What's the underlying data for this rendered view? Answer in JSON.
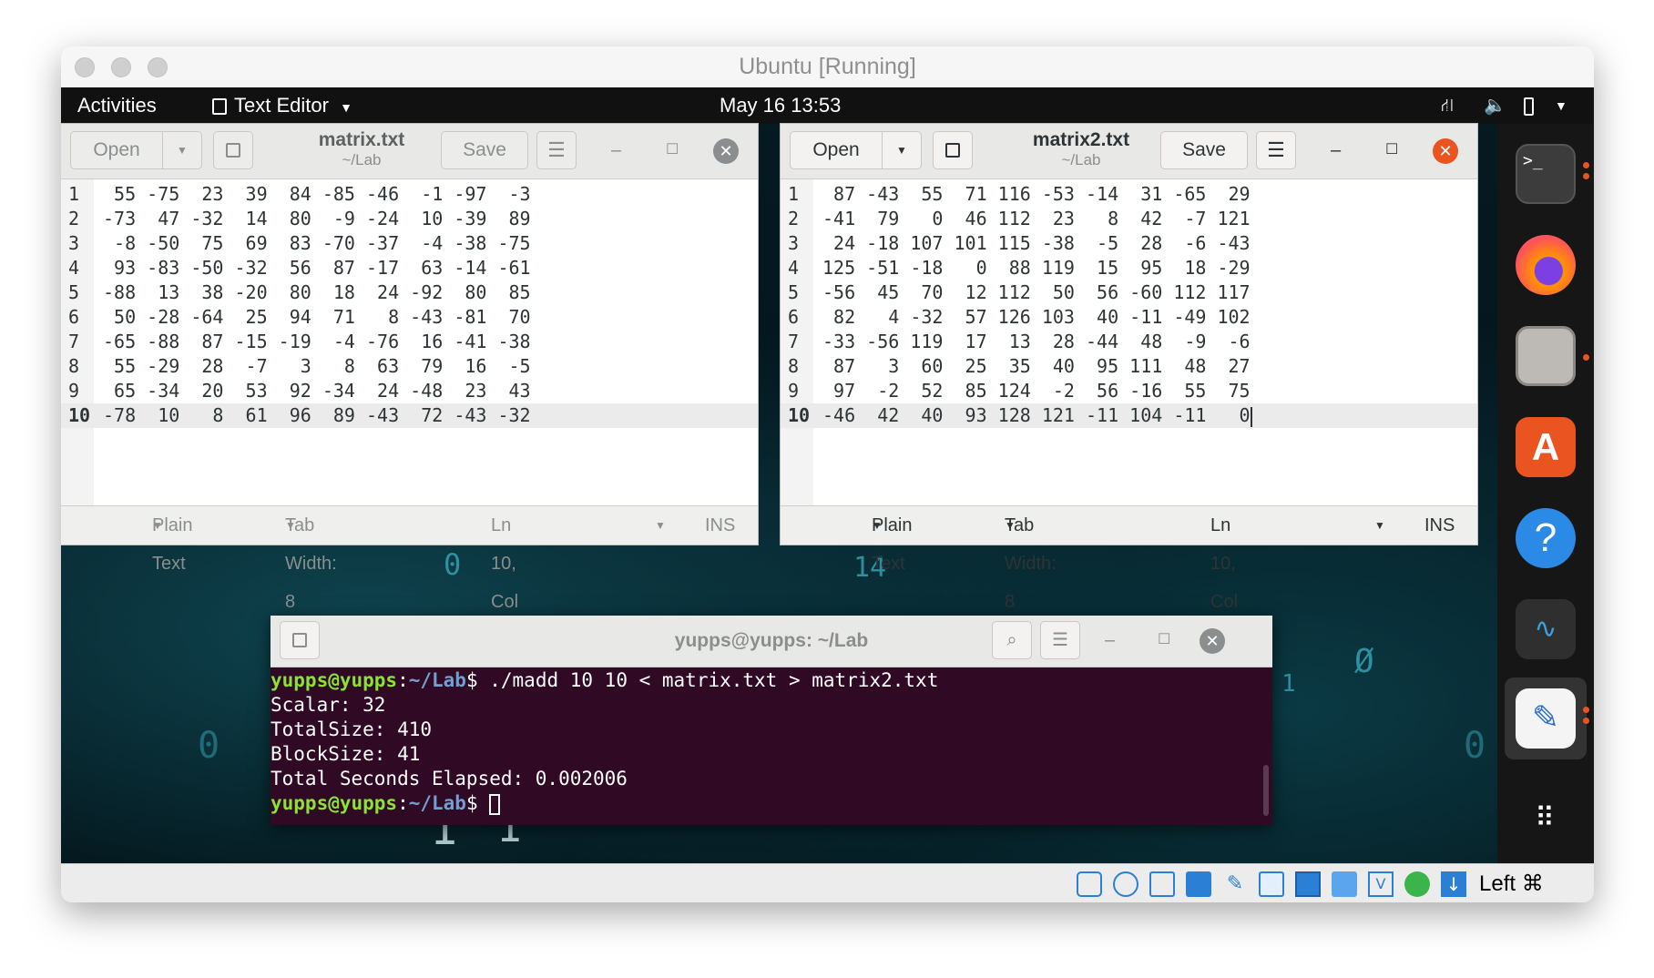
{
  "vbox": {
    "title": "Ubuntu [Running]",
    "host_key": "Left ⌘"
  },
  "topbar": {
    "activities": "Activities",
    "app_menu": "Text Editor",
    "clock": "May 16  13:53"
  },
  "editor_left": {
    "open_label": "Open",
    "save_label": "Save",
    "filename": "matrix.txt",
    "path": "~/Lab",
    "lines": [
      {
        "n": "1",
        "t": " 55 -75  23  39  84 -85 -46  -1 -97  -3"
      },
      {
        "n": "2",
        "t": "-73  47 -32  14  80  -9 -24  10 -39  89"
      },
      {
        "n": "3",
        "t": " -8 -50  75  69  83 -70 -37  -4 -38 -75"
      },
      {
        "n": "4",
        "t": " 93 -83 -50 -32  56  87 -17  63 -14 -61"
      },
      {
        "n": "5",
        "t": "-88  13  38 -20  80  18  24 -92  80  85"
      },
      {
        "n": "6",
        "t": " 50 -28 -64  25  94  71   8 -43 -81  70"
      },
      {
        "n": "7",
        "t": "-65 -88  87 -15 -19  -4 -76  16 -41 -38"
      },
      {
        "n": "8",
        "t": " 55 -29  28  -7   3   8  63  79  16  -5"
      },
      {
        "n": "9",
        "t": " 65 -34  20  53  92 -34  24 -48  23  43"
      },
      {
        "n": "10",
        "t": "-78  10   8  61  96  89 -43  72 -43 -32"
      }
    ],
    "status": {
      "syntax": "Plain Text",
      "tab_width": "Tab Width: 8",
      "position": "Ln 10, Col 41",
      "mode": "INS"
    }
  },
  "editor_right": {
    "open_label": "Open",
    "save_label": "Save",
    "filename": "matrix2.txt",
    "path": "~/Lab",
    "lines": [
      {
        "n": "1",
        "t": " 87 -43  55  71 116 -53 -14  31 -65  29"
      },
      {
        "n": "2",
        "t": "-41  79   0  46 112  23   8  42  -7 121"
      },
      {
        "n": "3",
        "t": " 24 -18 107 101 115 -38  -5  28  -6 -43"
      },
      {
        "n": "4",
        "t": "125 -51 -18   0  88 119  15  95  18 -29"
      },
      {
        "n": "5",
        "t": "-56  45  70  12 112  50  56 -60 112 117"
      },
      {
        "n": "6",
        "t": " 82   4 -32  57 126 103  40 -11 -49 102"
      },
      {
        "n": "7",
        "t": "-33 -56 119  17  13  28 -44  48  -9  -6"
      },
      {
        "n": "8",
        "t": " 87   3  60  25  35  40  95 111  48  27"
      },
      {
        "n": "9",
        "t": " 97  -2  52  85 124  -2  56 -16  55  75"
      },
      {
        "n": "10",
        "t": "-46  42  40  93 128 121 -11 104 -11   0"
      }
    ],
    "status": {
      "syntax": "Plain Text",
      "tab_width": "Tab Width: 8",
      "position": "Ln 10, Col 41",
      "mode": "INS"
    }
  },
  "terminal": {
    "title": "yupps@yupps: ~/Lab",
    "prompt_user": "yupps@yupps",
    "prompt_path": "~/Lab",
    "command": " ./madd 10 10 < matrix.txt > matrix2.txt",
    "output": [
      "Scalar: 32",
      "TotalSize: 410",
      "BlockSize: 41",
      "Total Seconds Elapsed: 0.002006"
    ]
  },
  "colors": {
    "ubuntu_orange": "#e95420",
    "terminal_bg": "#300a24",
    "prompt_green": "#8ae234",
    "prompt_blue": "#729fcf"
  },
  "dock_icons": [
    "terminal-icon",
    "firefox-icon",
    "files-icon",
    "software-icon",
    "help-icon",
    "system-monitor-icon",
    "text-editor-icon",
    "show-apps-icon"
  ]
}
